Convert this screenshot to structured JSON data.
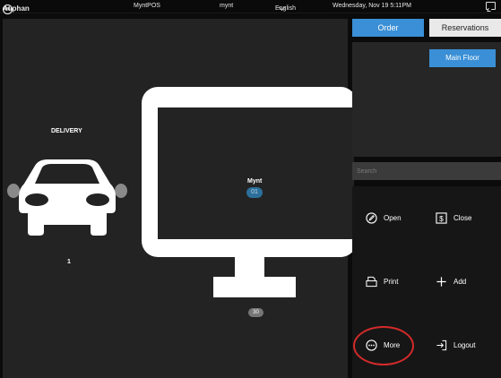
{
  "topbar": {
    "brand": "Auphan",
    "brand_mark": "(a)",
    "app": "MyntPOS",
    "user": "mynt",
    "language": "English",
    "datetime": "Wednesday, Nov 19 5:11PM"
  },
  "floor": {
    "delivery_label": "DELIVERY",
    "delivery_count": "1",
    "table": {
      "name": "Mynt",
      "number": "01",
      "count": "30"
    }
  },
  "tabs": {
    "order": "Order",
    "reservations": "Reservations"
  },
  "area": {
    "main_floor": "Main Floor"
  },
  "search": {
    "placeholder": "Search"
  },
  "actions": {
    "open": "Open",
    "close": "Close",
    "print": "Print",
    "add": "Add",
    "more": "More",
    "logout": "Logout"
  },
  "colors": {
    "accent": "#3a8fd6",
    "highlight": "#d42a2a",
    "table_badge": "#2b6f9a"
  }
}
